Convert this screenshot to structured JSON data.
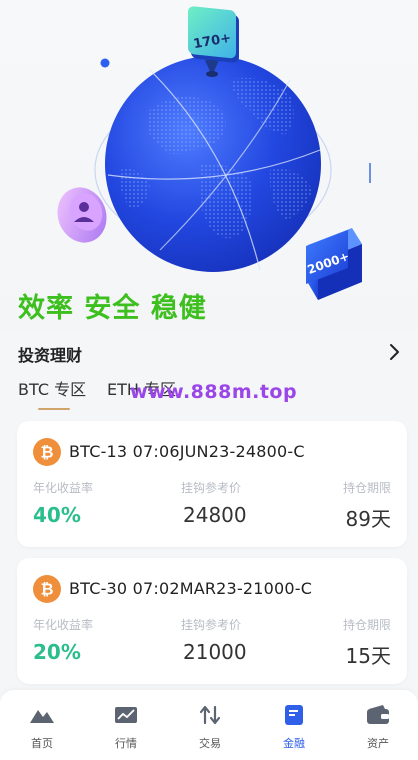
{
  "hero": {
    "badge_top": "170+",
    "badge_bottom": "2000+",
    "slogan": "效率 安全 稳健",
    "colors": {
      "globe": "#1e3fd8",
      "slogan": "#3dbf1e"
    }
  },
  "section": {
    "title": "投资理财",
    "icon": "chevron-right-icon"
  },
  "tabs": [
    {
      "label": "BTC 专区",
      "active": true
    },
    {
      "label": "ETH 专区",
      "active": false
    }
  ],
  "watermark": "www.888m.top",
  "products": [
    {
      "title": "BTC-13 07:06JUN23-24800-C",
      "yield_label": "年化收益率",
      "yield": "40%",
      "price_label": "挂钩参考价",
      "price": "24800",
      "period_label": "持仓期限",
      "period": "89天"
    },
    {
      "title": "BTC-30 07:02MAR23-21000-C",
      "yield_label": "年化收益率",
      "yield": "20%",
      "price_label": "挂钩参考价",
      "price": "21000",
      "period_label": "持仓期限",
      "period": "15天"
    }
  ],
  "nav": [
    {
      "label": "首页",
      "icon": "home-mountain-icon",
      "active": false
    },
    {
      "label": "行情",
      "icon": "market-chart-icon",
      "active": false
    },
    {
      "label": "交易",
      "icon": "trade-arrows-icon",
      "active": false
    },
    {
      "label": "金融",
      "icon": "finance-doc-icon",
      "active": true
    },
    {
      "label": "资产",
      "icon": "wallet-icon",
      "active": false
    }
  ],
  "colors": {
    "accent": "#3060e8",
    "yield": "#2bbd8c",
    "tab_underline": "#cfa56b"
  }
}
